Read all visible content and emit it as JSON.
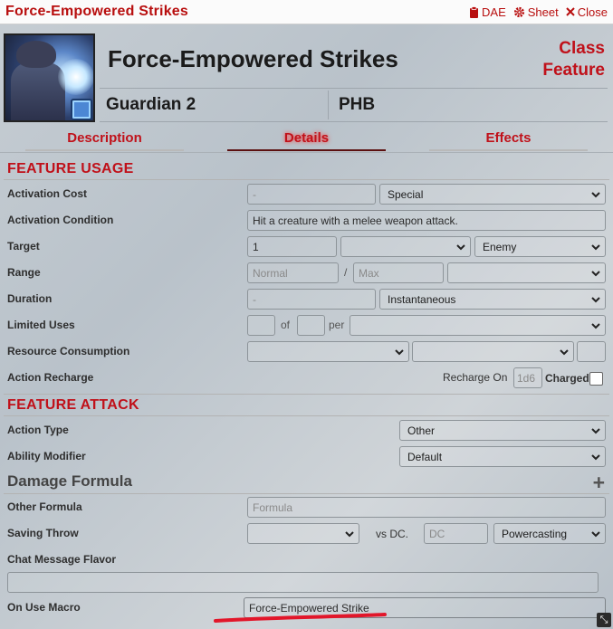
{
  "window": {
    "title": "Force-Empowered Strikes",
    "controls": {
      "dae": "DAE",
      "sheet": "Sheet",
      "close": "Close"
    }
  },
  "header": {
    "name": "Force-Empowered Strikes",
    "type_line1": "Class",
    "type_line2": "Feature",
    "requirements": "Guardian 2",
    "source": "PHB"
  },
  "tabs": [
    {
      "label": "Description",
      "active": false
    },
    {
      "label": "Details",
      "active": true
    },
    {
      "label": "Effects",
      "active": false
    }
  ],
  "feature_usage": {
    "title": "FEATURE USAGE",
    "activation_cost": {
      "label": "Activation Cost",
      "value_placeholder": "-",
      "type": "Special"
    },
    "activation_condition": {
      "label": "Activation Condition",
      "value": "Hit a creature with a melee weapon attack."
    },
    "target": {
      "label": "Target",
      "value": "1",
      "units": "",
      "type": "Enemy"
    },
    "range": {
      "label": "Range",
      "normal_placeholder": "Normal",
      "separator": "/",
      "max_placeholder": "Max",
      "units": ""
    },
    "duration": {
      "label": "Duration",
      "value_placeholder": "-",
      "units": "Instantaneous"
    },
    "limited_uses": {
      "label": "Limited Uses",
      "of": "of",
      "per": "per",
      "period": ""
    },
    "resource_consumption": {
      "label": "Resource Consumption",
      "type": "",
      "target": "",
      "amount": ""
    },
    "action_recharge": {
      "label": "Action Recharge",
      "recharge_on": "Recharge On",
      "recharge_placeholder": "1d6",
      "charged": "Charged"
    }
  },
  "feature_attack": {
    "title": "FEATURE ATTACK",
    "action_type": {
      "label": "Action Type",
      "value": "Other"
    },
    "ability_modifier": {
      "label": "Ability Modifier",
      "value": "Default"
    },
    "damage_formula_title": "Damage Formula",
    "other_formula": {
      "label": "Other Formula",
      "placeholder": "Formula"
    },
    "saving_throw": {
      "label": "Saving Throw",
      "ability": "",
      "vs_dc": "vs DC.",
      "dc_placeholder": "DC",
      "scaling": "Powercasting"
    },
    "chat_flavor": {
      "label": "Chat Message Flavor",
      "value": ""
    },
    "on_use_macro": {
      "label": "On Use Macro",
      "value": "Force-Empowered Strike"
    }
  },
  "colors": {
    "accent": "#c0111a",
    "underline_annotation": "#e2162a"
  }
}
